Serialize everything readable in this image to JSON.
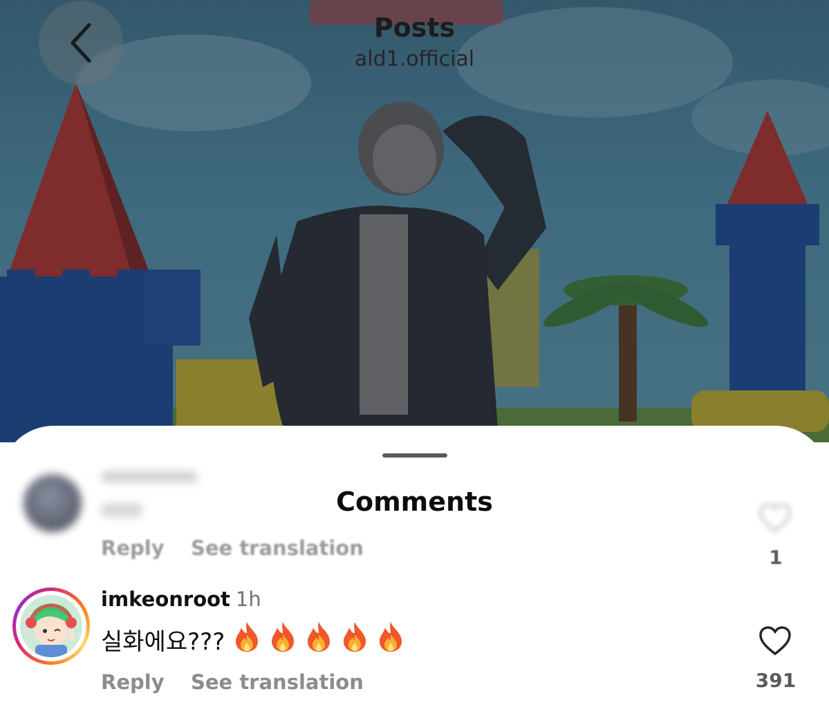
{
  "nav": {
    "title": "Posts",
    "account": "ald1.official",
    "back_icon": "chevron-left-icon"
  },
  "sheet": {
    "title": "Comments"
  },
  "comments": [
    {
      "username": "",
      "time": "",
      "text": "",
      "reply_label": "Reply",
      "translate_label": "See translation",
      "likes": "1",
      "blurred": true
    },
    {
      "username": "imkeonroot",
      "time": "1h",
      "text": "실화에요???",
      "emoji_count": 5,
      "emoji": "fire-emoji",
      "reply_label": "Reply",
      "translate_label": "See translation",
      "likes": "391",
      "blurred": false
    }
  ],
  "colors": {
    "story_ring": [
      "#d62976",
      "#fa7e1e",
      "#feda75",
      "#962fbf"
    ],
    "muted_text": "#737373",
    "heart_outline": "#262626"
  }
}
